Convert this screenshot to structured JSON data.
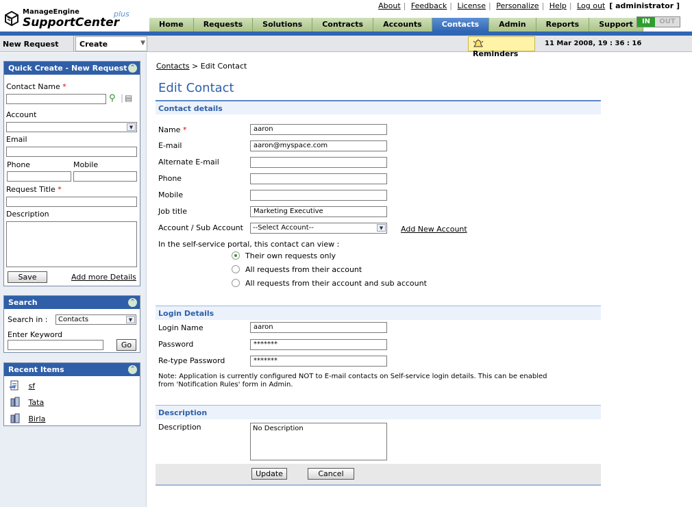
{
  "brand": {
    "vendor": "ManageEngine",
    "product": "SupportCenter",
    "suffix": "plus"
  },
  "top_links": {
    "about": "About",
    "feedback": "Feedback",
    "license": "License",
    "personalize": "Personalize",
    "help": "Help",
    "logout": "Log out",
    "user": "[ administrator ]"
  },
  "tabs": [
    {
      "label": "Home"
    },
    {
      "label": "Requests"
    },
    {
      "label": "Solutions"
    },
    {
      "label": "Contracts"
    },
    {
      "label": "Accounts"
    },
    {
      "label": "Contacts"
    },
    {
      "label": "Admin"
    },
    {
      "label": "Reports"
    },
    {
      "label": "Support"
    }
  ],
  "status": {
    "in": "IN",
    "out": "OUT"
  },
  "subbar": {
    "new_request": "New Request",
    "create": "Create",
    "reminders": "Reminders",
    "datetime": "11 Mar 2008, 19 : 36 : 16"
  },
  "quick_create": {
    "title": "Quick Create - New Request",
    "contact_name": "Contact Name",
    "account": "Account",
    "email": "Email",
    "phone": "Phone",
    "mobile": "Mobile",
    "request_title": "Request Title",
    "description": "Description",
    "save": "Save",
    "add_more": "Add more Details",
    "required": "*"
  },
  "search": {
    "title": "Search",
    "search_in": "Search in :",
    "search_in_value": "Contacts",
    "keyword": "Enter Keyword",
    "go": "Go"
  },
  "recent": {
    "title": "Recent Items",
    "items": [
      "sf",
      "Tata",
      "Birla"
    ]
  },
  "main": {
    "breadcrumb_link": "Contacts",
    "breadcrumb_rest": " > Edit Contact",
    "title": "Edit Contact",
    "contact_section": "Contact details",
    "fields": {
      "name": {
        "label": "Name",
        "value": "aaron"
      },
      "email": {
        "label": "E-mail",
        "value": "aaron@myspace.com"
      },
      "alt_email": {
        "label": "Alternate E-mail",
        "value": ""
      },
      "phone": {
        "label": "Phone",
        "value": ""
      },
      "mobile": {
        "label": "Mobile",
        "value": ""
      },
      "job_title": {
        "label": "Job title",
        "value": "Marketing Executive"
      },
      "account": {
        "label": "Account / Sub Account",
        "value": "--Select Account--"
      }
    },
    "add_account": "Add New Account",
    "portal_text": "In the self-service portal, this contact can view :",
    "portal_options": [
      "Their own requests only",
      "All requests from their account",
      "All requests from their account and sub account"
    ],
    "login_section": "Login Details",
    "login_name": {
      "label": "Login Name",
      "value": "aaron"
    },
    "password": {
      "label": "Password",
      "value": "*******"
    },
    "retype": {
      "label": "Re-type Password",
      "value": "*******"
    },
    "note_line1": "Note: Application is currently configured NOT to E-mail contacts on Self-service login details. This can be enabled",
    "note_line2": "from 'Notification Rules' form in Admin.",
    "desc_section": "Description",
    "desc_label": "Description",
    "desc_value": "No Description",
    "update": "Update",
    "cancel": "Cancel"
  }
}
